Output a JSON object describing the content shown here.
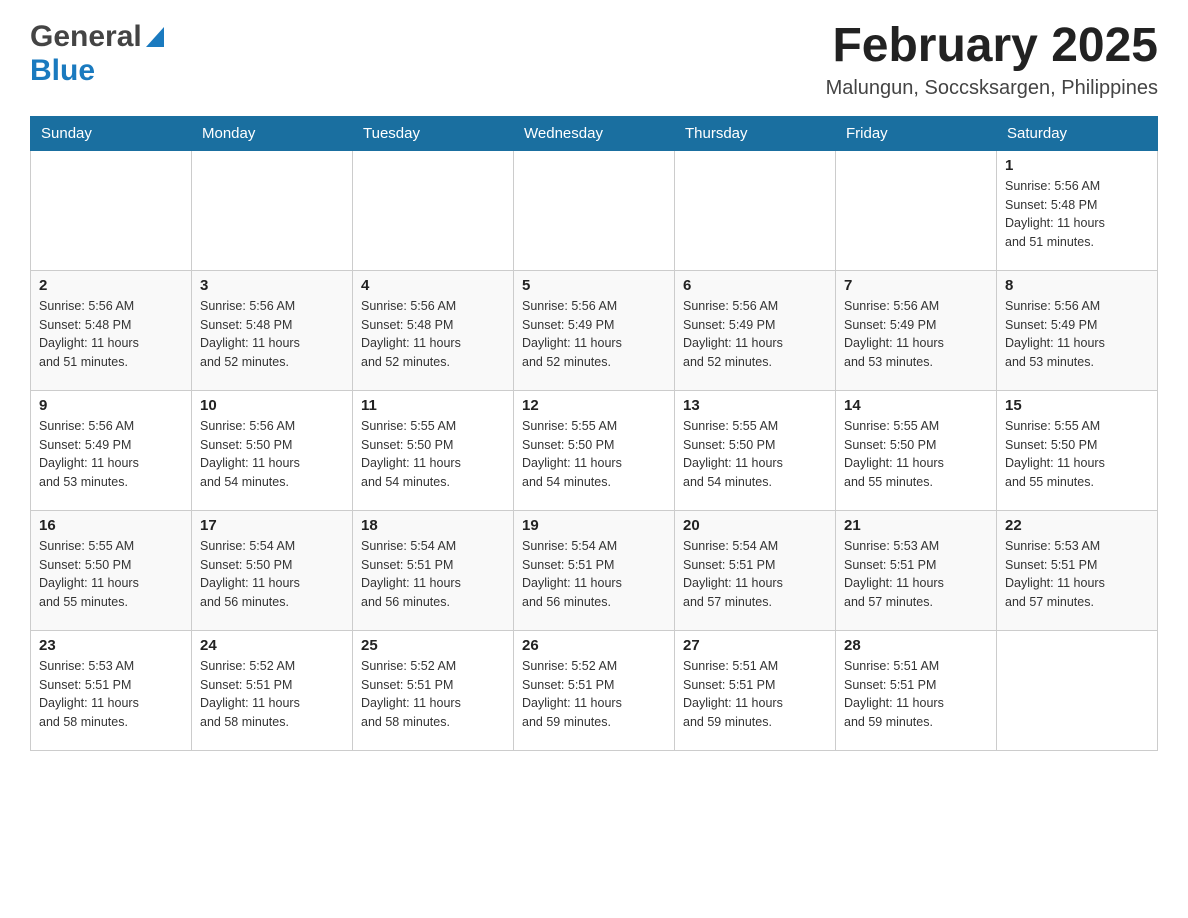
{
  "header": {
    "logo_general": "General",
    "logo_blue": "Blue",
    "title": "February 2025",
    "subtitle": "Malungun, Soccsksargen, Philippines"
  },
  "days_of_week": [
    "Sunday",
    "Monday",
    "Tuesday",
    "Wednesday",
    "Thursday",
    "Friday",
    "Saturday"
  ],
  "weeks": [
    {
      "days": [
        {
          "number": "",
          "info": ""
        },
        {
          "number": "",
          "info": ""
        },
        {
          "number": "",
          "info": ""
        },
        {
          "number": "",
          "info": ""
        },
        {
          "number": "",
          "info": ""
        },
        {
          "number": "",
          "info": ""
        },
        {
          "number": "1",
          "info": "Sunrise: 5:56 AM\nSunset: 5:48 PM\nDaylight: 11 hours\nand 51 minutes."
        }
      ]
    },
    {
      "days": [
        {
          "number": "2",
          "info": "Sunrise: 5:56 AM\nSunset: 5:48 PM\nDaylight: 11 hours\nand 51 minutes."
        },
        {
          "number": "3",
          "info": "Sunrise: 5:56 AM\nSunset: 5:48 PM\nDaylight: 11 hours\nand 52 minutes."
        },
        {
          "number": "4",
          "info": "Sunrise: 5:56 AM\nSunset: 5:48 PM\nDaylight: 11 hours\nand 52 minutes."
        },
        {
          "number": "5",
          "info": "Sunrise: 5:56 AM\nSunset: 5:49 PM\nDaylight: 11 hours\nand 52 minutes."
        },
        {
          "number": "6",
          "info": "Sunrise: 5:56 AM\nSunset: 5:49 PM\nDaylight: 11 hours\nand 52 minutes."
        },
        {
          "number": "7",
          "info": "Sunrise: 5:56 AM\nSunset: 5:49 PM\nDaylight: 11 hours\nand 53 minutes."
        },
        {
          "number": "8",
          "info": "Sunrise: 5:56 AM\nSunset: 5:49 PM\nDaylight: 11 hours\nand 53 minutes."
        }
      ]
    },
    {
      "days": [
        {
          "number": "9",
          "info": "Sunrise: 5:56 AM\nSunset: 5:49 PM\nDaylight: 11 hours\nand 53 minutes."
        },
        {
          "number": "10",
          "info": "Sunrise: 5:56 AM\nSunset: 5:50 PM\nDaylight: 11 hours\nand 54 minutes."
        },
        {
          "number": "11",
          "info": "Sunrise: 5:55 AM\nSunset: 5:50 PM\nDaylight: 11 hours\nand 54 minutes."
        },
        {
          "number": "12",
          "info": "Sunrise: 5:55 AM\nSunset: 5:50 PM\nDaylight: 11 hours\nand 54 minutes."
        },
        {
          "number": "13",
          "info": "Sunrise: 5:55 AM\nSunset: 5:50 PM\nDaylight: 11 hours\nand 54 minutes."
        },
        {
          "number": "14",
          "info": "Sunrise: 5:55 AM\nSunset: 5:50 PM\nDaylight: 11 hours\nand 55 minutes."
        },
        {
          "number": "15",
          "info": "Sunrise: 5:55 AM\nSunset: 5:50 PM\nDaylight: 11 hours\nand 55 minutes."
        }
      ]
    },
    {
      "days": [
        {
          "number": "16",
          "info": "Sunrise: 5:55 AM\nSunset: 5:50 PM\nDaylight: 11 hours\nand 55 minutes."
        },
        {
          "number": "17",
          "info": "Sunrise: 5:54 AM\nSunset: 5:50 PM\nDaylight: 11 hours\nand 56 minutes."
        },
        {
          "number": "18",
          "info": "Sunrise: 5:54 AM\nSunset: 5:51 PM\nDaylight: 11 hours\nand 56 minutes."
        },
        {
          "number": "19",
          "info": "Sunrise: 5:54 AM\nSunset: 5:51 PM\nDaylight: 11 hours\nand 56 minutes."
        },
        {
          "number": "20",
          "info": "Sunrise: 5:54 AM\nSunset: 5:51 PM\nDaylight: 11 hours\nand 57 minutes."
        },
        {
          "number": "21",
          "info": "Sunrise: 5:53 AM\nSunset: 5:51 PM\nDaylight: 11 hours\nand 57 minutes."
        },
        {
          "number": "22",
          "info": "Sunrise: 5:53 AM\nSunset: 5:51 PM\nDaylight: 11 hours\nand 57 minutes."
        }
      ]
    },
    {
      "days": [
        {
          "number": "23",
          "info": "Sunrise: 5:53 AM\nSunset: 5:51 PM\nDaylight: 11 hours\nand 58 minutes."
        },
        {
          "number": "24",
          "info": "Sunrise: 5:52 AM\nSunset: 5:51 PM\nDaylight: 11 hours\nand 58 minutes."
        },
        {
          "number": "25",
          "info": "Sunrise: 5:52 AM\nSunset: 5:51 PM\nDaylight: 11 hours\nand 58 minutes."
        },
        {
          "number": "26",
          "info": "Sunrise: 5:52 AM\nSunset: 5:51 PM\nDaylight: 11 hours\nand 59 minutes."
        },
        {
          "number": "27",
          "info": "Sunrise: 5:51 AM\nSunset: 5:51 PM\nDaylight: 11 hours\nand 59 minutes."
        },
        {
          "number": "28",
          "info": "Sunrise: 5:51 AM\nSunset: 5:51 PM\nDaylight: 11 hours\nand 59 minutes."
        },
        {
          "number": "",
          "info": ""
        }
      ]
    }
  ]
}
